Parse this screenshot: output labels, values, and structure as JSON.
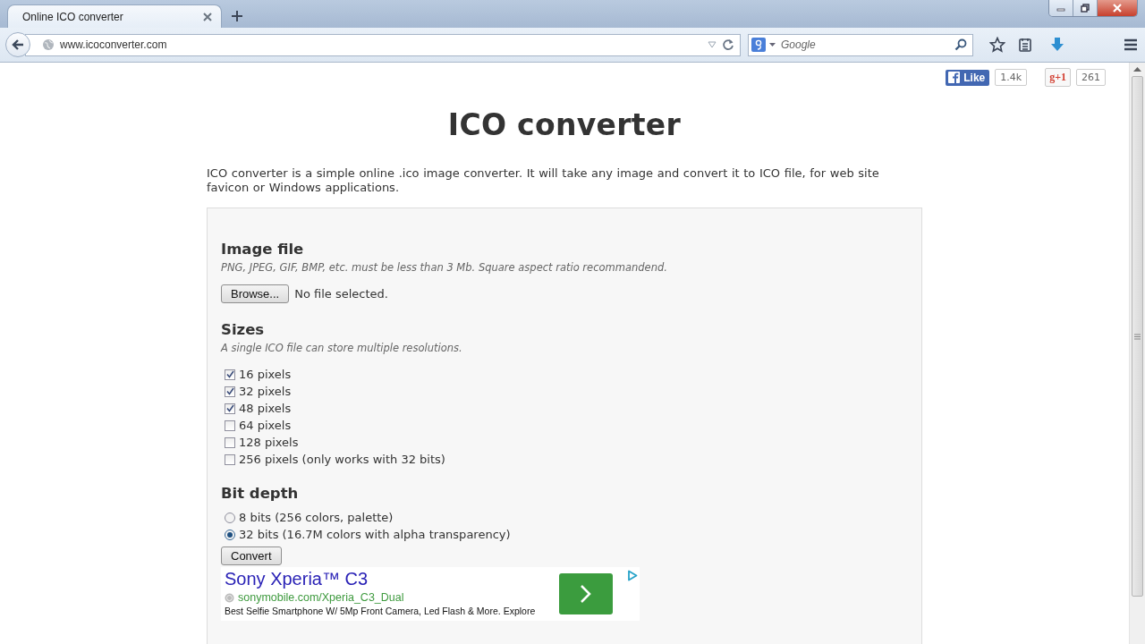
{
  "browser": {
    "tabs": [
      {
        "title": "Online ICO converter",
        "selected": true
      }
    ],
    "address": "www.icoconverter.com",
    "search": {
      "placeholder": "Google"
    }
  },
  "social": {
    "like_label": "Like",
    "like_count": "1.4k",
    "plus_label": "g+1",
    "plus_count": "261"
  },
  "page": {
    "title": "ICO converter",
    "intro": "ICO converter is a simple online .ico image converter. It will take any image and convert it to ICO file, for web site favicon or Windows applications.",
    "image_file": {
      "heading": "Image file",
      "hint": "PNG, JPEG, GIF, BMP, etc. must be less than 3 Mb. Square aspect ratio recommandend.",
      "browse_button": "Browse...",
      "status": "No file selected."
    },
    "sizes": {
      "heading": "Sizes",
      "hint": "A single ICO file can store multiple resolutions.",
      "options": [
        {
          "label": "16 pixels",
          "checked": true
        },
        {
          "label": "32 pixels",
          "checked": true
        },
        {
          "label": "48 pixels",
          "checked": true
        },
        {
          "label": "64 pixels",
          "checked": false
        },
        {
          "label": "128 pixels",
          "checked": false
        },
        {
          "label": "256 pixels (only works with 32 bits)",
          "checked": false
        }
      ]
    },
    "bit_depth": {
      "heading": "Bit depth",
      "options": [
        {
          "label": "8 bits (256 colors, palette)",
          "selected": false
        },
        {
          "label": "32 bits (16.7M colors with alpha transparency)",
          "selected": true
        }
      ]
    },
    "convert_button": "Convert",
    "ad": {
      "title": "Sony Xperia™ C3",
      "url": "sonymobile.com/Xperia_C3_Dual",
      "description": "Best Selfie Smartphone W/ 5Mp Front Camera, Led Flash & More. Explore"
    }
  }
}
